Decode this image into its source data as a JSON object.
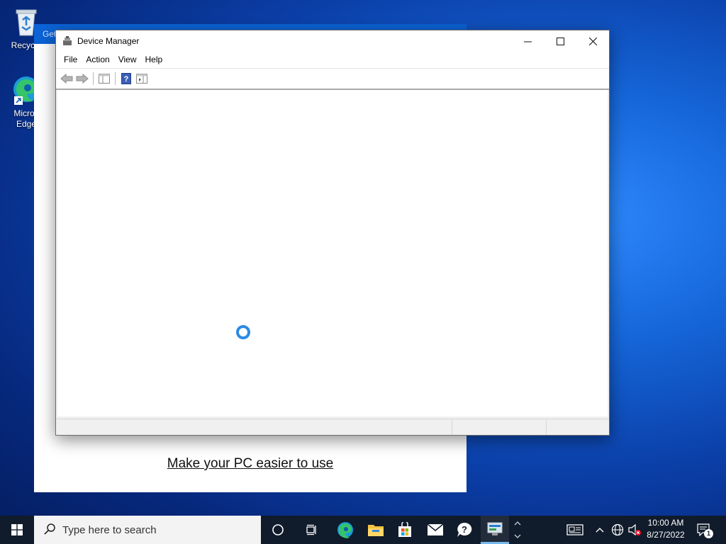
{
  "desktop": {
    "icons": [
      {
        "label": "Recycle"
      },
      {
        "label": "Micros Edge"
      }
    ]
  },
  "background_window": {
    "title": "Get",
    "link_text": "Make your PC easier to use"
  },
  "device_manager": {
    "title": "Device Manager",
    "menu": [
      "File",
      "Action",
      "View",
      "Help"
    ],
    "toolbar_icons": [
      "back-arrow-icon",
      "forward-arrow-icon",
      "show-hide-console-tree-icon",
      "help-icon",
      "properties-view-icon"
    ],
    "content_state": "loading"
  },
  "taskbar": {
    "search_placeholder": "Type here to search",
    "pinned": [
      "cortana-icon",
      "task-view-icon",
      "edge-icon",
      "file-explorer-icon",
      "store-icon",
      "mail-icon",
      "get-help-icon",
      "device-manager-icon"
    ],
    "tray": [
      "news-icon",
      "chevron-up-icon",
      "network-icon",
      "volume-muted-icon",
      "notification-icon"
    ],
    "time": "10:00 AM",
    "date": "8/27/2022",
    "notification_count": "1"
  },
  "colors": {
    "accent": "#0078d7",
    "taskbar": "#101b2b",
    "spinner": "#2b8ae6"
  }
}
